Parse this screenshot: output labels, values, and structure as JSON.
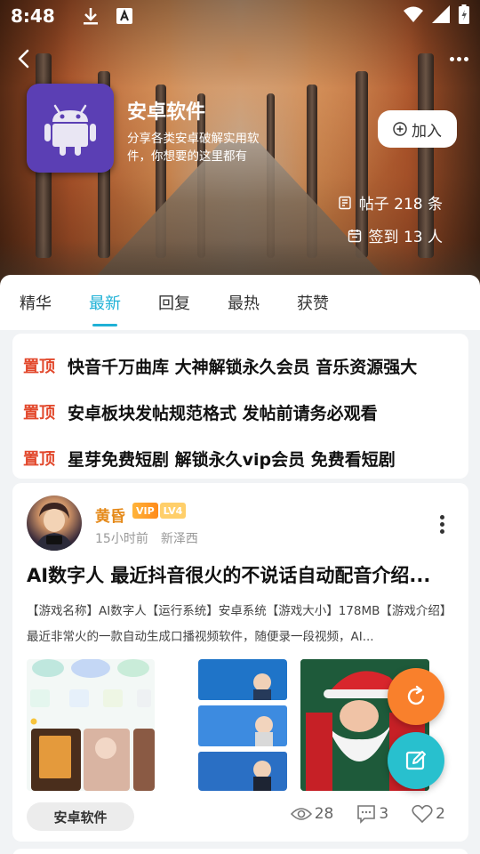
{
  "status_bar": {
    "time": "8:48"
  },
  "header": {
    "app_name": "安卓软件",
    "description": "分享各类安卓破解实用软件，你想要的这里都有",
    "join_label": "加入",
    "posts_stat": "帖子 218 条",
    "checkin_stat": "签到 13 人"
  },
  "tabs": [
    {
      "label": "精华"
    },
    {
      "label": "最新",
      "active": true
    },
    {
      "label": "回复"
    },
    {
      "label": "最热"
    },
    {
      "label": "获赞"
    }
  ],
  "pinned": {
    "tag": "置顶",
    "items": [
      "快音千万曲库 大神解锁永久会员 音乐资源强大",
      "安卓板块发帖规范格式 发帖前请务必观看",
      "星芽免费短剧 解锁永久vip会员 免费看短剧"
    ]
  },
  "post": {
    "username": "黄昏",
    "vip_badge": "VIP",
    "level_badge": "LV4",
    "time_ago": "15小时前",
    "location": "新泽西",
    "title": "AI数字人 最近抖音很火的不说话自动配音介绍...",
    "body": "【游戏名称】AI数字人【运行系统】安卓系统【游戏大小】178MB【游戏介绍】最近非常火的一款自动生成口播视频软件，随便录一段视频，AI...",
    "board_tag": "安卓软件",
    "views": "28",
    "comments": "3",
    "likes": "2"
  },
  "colors": {
    "accent": "#1fb1d6",
    "pinned_tag": "#e2482c",
    "username": "#e58a1b",
    "fab_refresh": "#f9802c",
    "fab_edit": "#28c0ce"
  }
}
